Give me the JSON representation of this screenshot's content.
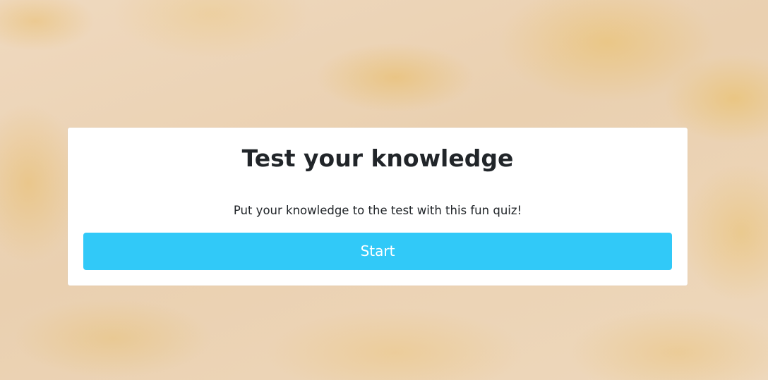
{
  "quiz": {
    "title": "Test your knowledge",
    "description": "Put your knowledge to the test with this fun quiz!",
    "start_label": "Start"
  },
  "colors": {
    "button": "#31c9f8",
    "card": "#ffffff",
    "text": "#212529",
    "background": "#ecd3b6"
  }
}
